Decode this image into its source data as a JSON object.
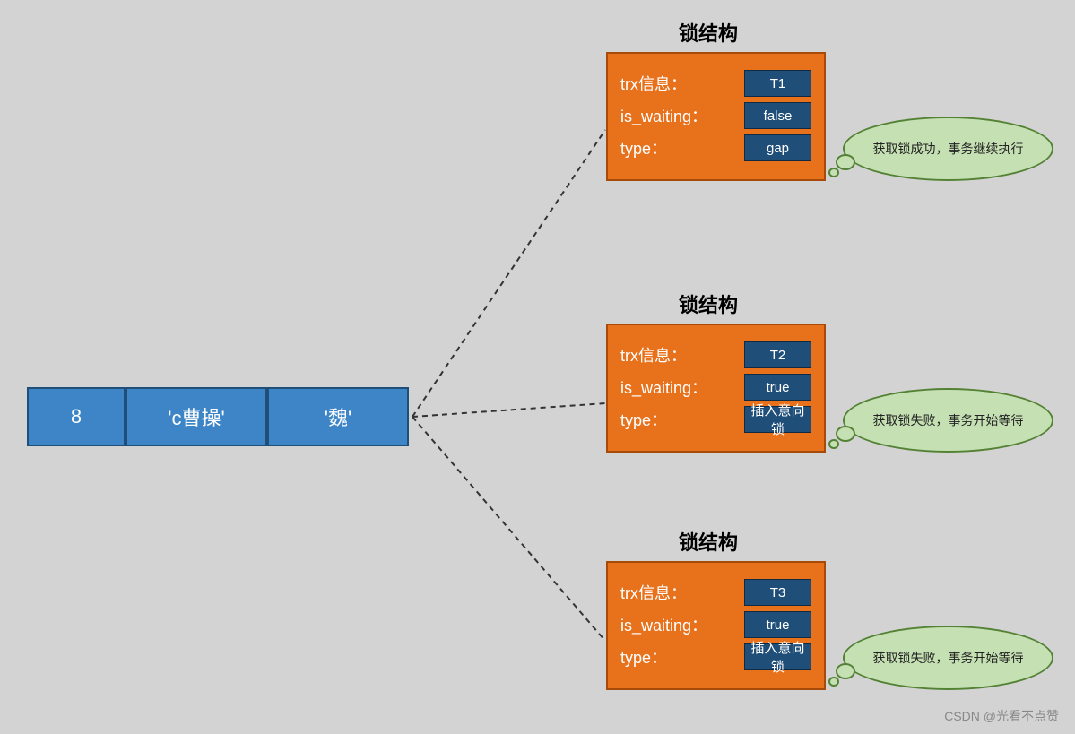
{
  "record": {
    "cells": [
      "8",
      "'c曹操'",
      "'魏'"
    ]
  },
  "locks": [
    {
      "title": "锁结构",
      "rows": {
        "trx_label": "trx信息：",
        "trx_value": "T1",
        "waiting_label": "is_waiting：",
        "waiting_value": "false",
        "type_label": "type：",
        "type_value": "gap"
      },
      "bubble": "获取锁成功，事务继续执行"
    },
    {
      "title": "锁结构",
      "rows": {
        "trx_label": "trx信息：",
        "trx_value": "T2",
        "waiting_label": "is_waiting：",
        "waiting_value": "true",
        "type_label": "type：",
        "type_value": "插入意向锁"
      },
      "bubble": "获取锁失败，事务开始等待"
    },
    {
      "title": "锁结构",
      "rows": {
        "trx_label": "trx信息：",
        "trx_value": "T3",
        "waiting_label": "is_waiting：",
        "waiting_value": "true",
        "type_label": "type：",
        "type_value": "插入意向锁"
      },
      "bubble": "获取锁失败，事务开始等待"
    }
  ],
  "watermark": "CSDN @光看不点赞"
}
